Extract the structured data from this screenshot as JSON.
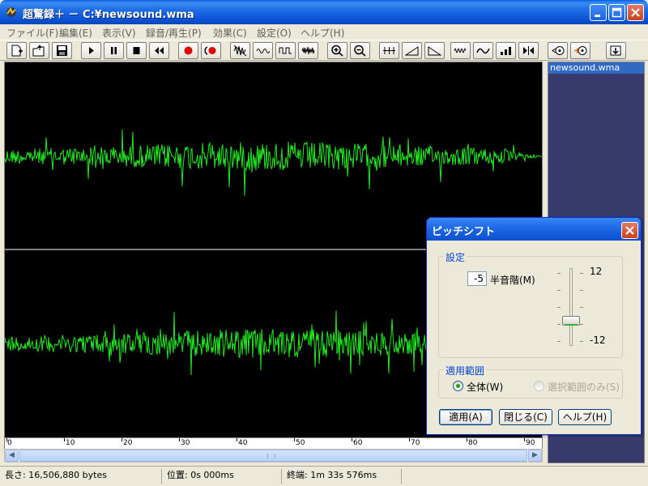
{
  "window": {
    "title": "超驚録＋ － C:¥newsound.wma"
  },
  "menu": [
    {
      "label": "ファイル(F)"
    },
    {
      "label": "編集(E)"
    },
    {
      "label": "表示(V)"
    },
    {
      "label": "録音/再生(P)"
    },
    {
      "label": "効果(C)"
    },
    {
      "label": "設定(O)"
    },
    {
      "label": "ヘルプ(H)"
    }
  ],
  "toolbar": [
    "new-file-icon",
    "open-file-icon",
    "save-icon",
    "play-icon",
    "pause-icon",
    "stop-icon",
    "rewind-icon",
    "record-icon",
    "record-loop-icon",
    "waveform-edit-icon",
    "wave-icon",
    "wave-square-icon",
    "wave-noise-icon",
    "zoom-in-icon",
    "zoom-out-icon",
    "normalize-icon",
    "fade-in-icon",
    "fade-out-icon",
    "echo-icon",
    "pitch-icon",
    "equalizer-icon",
    "trim-icon",
    "cd-import-icon",
    "cd-export-icon",
    "download-icon"
  ],
  "waveform": {
    "color": "#22e822",
    "background": "#000000",
    "divider_color": "#ffffff"
  },
  "ruler": {
    "labels": [
      "0",
      "10",
      "20",
      "30",
      "40",
      "50",
      "60",
      "70",
      "80",
      "90"
    ]
  },
  "file_list": {
    "items": [
      {
        "name": "newsound.wma",
        "selected": true
      }
    ]
  },
  "status": {
    "length": "長さ: 16,506,880 bytes",
    "position": "位置: 0s 000ms",
    "end": "終端: 1m 33s 576ms"
  },
  "dialog": {
    "title": "ピッチシフト",
    "settings_group": "設定",
    "semitone_value": "-5",
    "semitone_label": "半音階(M)",
    "slider_max_label": "12",
    "slider_min_label": "-12",
    "range_group": "適用範囲",
    "range_all": "全体(W)",
    "range_selection": "選択範囲のみ(S)",
    "apply_button": "適用(A)",
    "close_button": "閉じる(C)",
    "help_button": "ヘルプ(H)"
  }
}
